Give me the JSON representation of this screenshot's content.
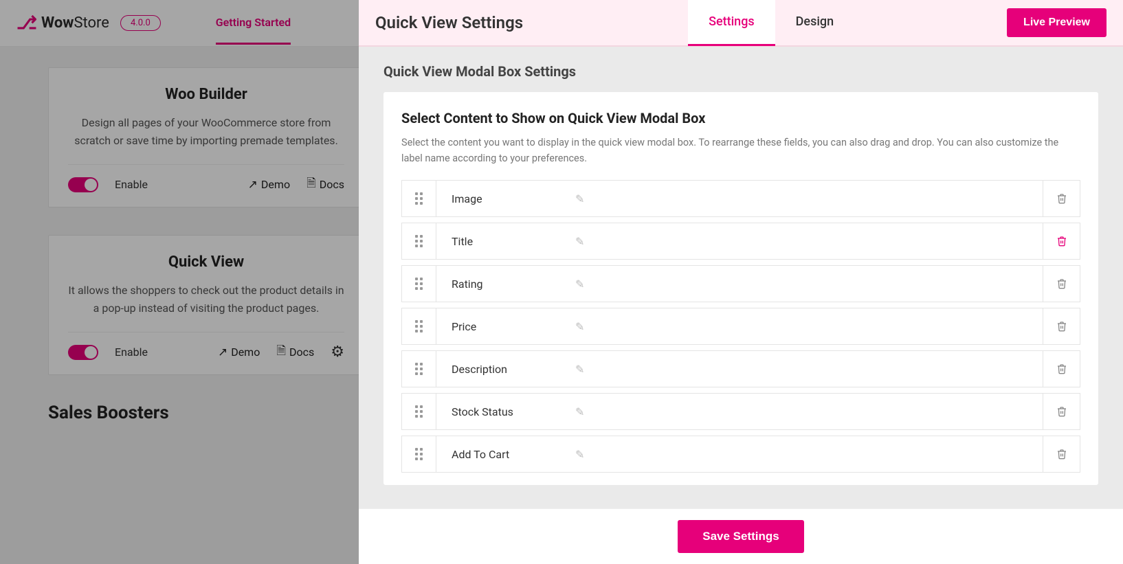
{
  "brand": {
    "name_left": "Wow",
    "name_right": "Store",
    "version": "4.0.0"
  },
  "nav": {
    "getting_started": "Getting Started"
  },
  "cards": [
    {
      "title": "Woo Builder",
      "desc": "Design all pages of your WooCommerce store from scratch or save time by importing premade templates.",
      "enable": "Enable",
      "demo": "Demo",
      "docs": "Docs",
      "has_gear": false
    },
    {
      "title": "Quick View",
      "desc": "It allows the shoppers to check out the product details in a pop-up instead of visiting the product pages.",
      "enable": "Enable",
      "demo": "Demo",
      "docs": "Docs",
      "has_gear": true
    }
  ],
  "section_heading": "Sales Boosters",
  "panel": {
    "title": "Quick View Settings",
    "tabs": {
      "settings": "Settings",
      "design": "Design"
    },
    "live_preview": "Live Preview",
    "section_header": "Quick View Modal Box Settings",
    "card_title": "Select Content to Show on Quick View Modal Box",
    "card_sub": "Select the content you want to display in the quick view modal box. To rearrange these fields, you can also drag and drop. You can also customize the label name according to your preferences.",
    "rows": [
      {
        "label": "Image",
        "danger": false
      },
      {
        "label": "Title",
        "danger": true
      },
      {
        "label": "Rating",
        "danger": false
      },
      {
        "label": "Price",
        "danger": false
      },
      {
        "label": "Description",
        "danger": false
      },
      {
        "label": "Stock Status",
        "danger": false
      },
      {
        "label": "Add To Cart",
        "danger": false
      }
    ],
    "save": "Save Settings"
  }
}
